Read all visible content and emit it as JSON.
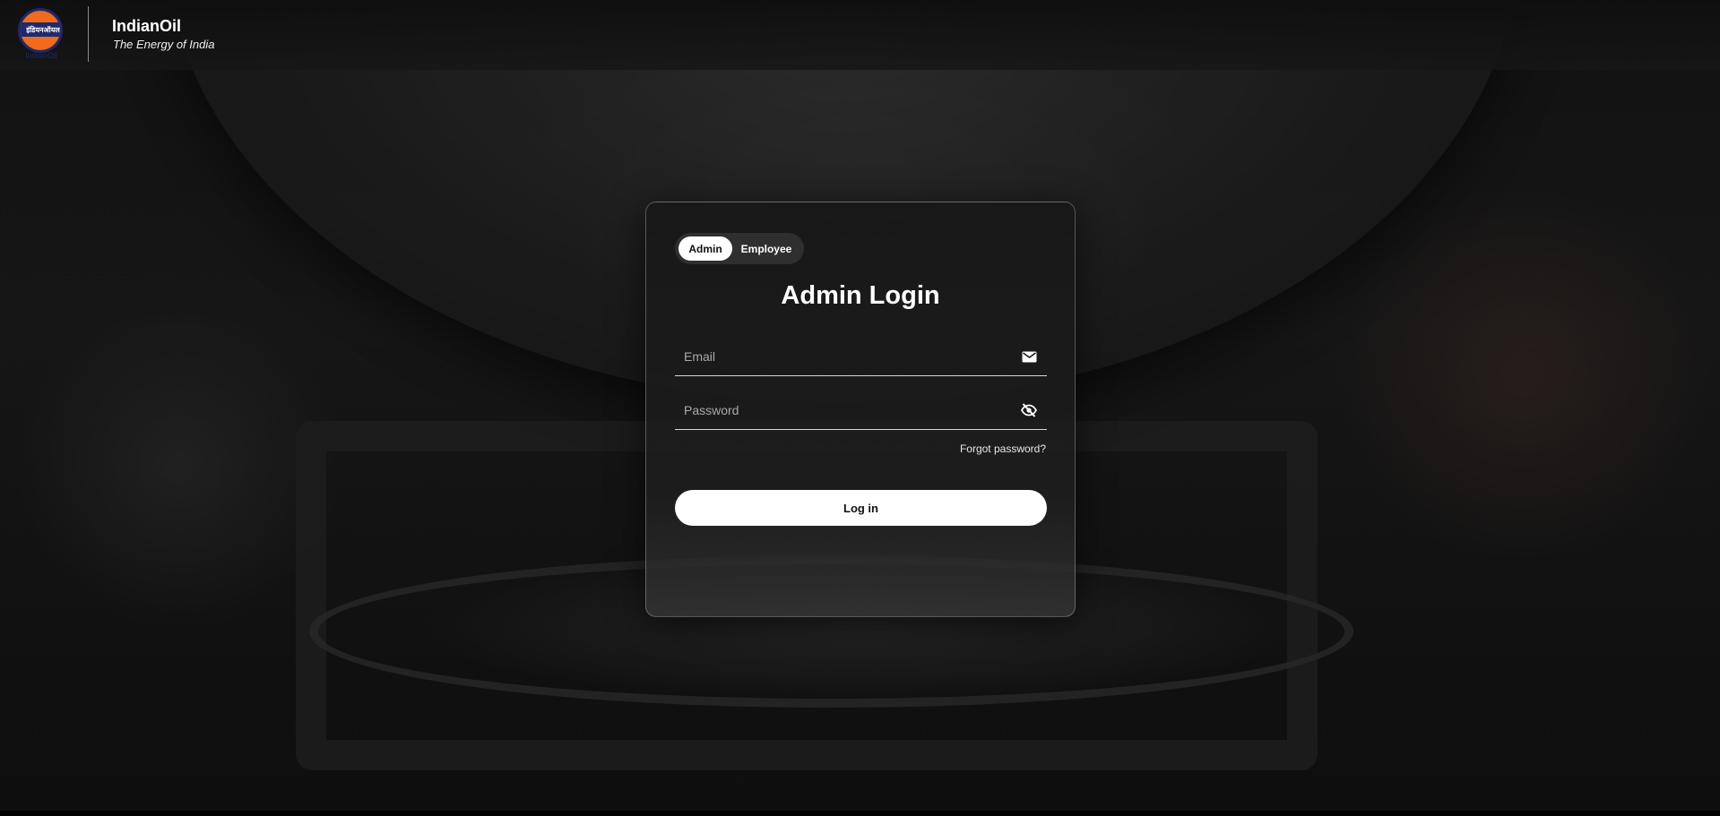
{
  "header": {
    "logo_text": "इंडियनऑयल",
    "logo_caption": "IndianOil",
    "brand_name": "IndianOil",
    "tagline": "The Energy of India"
  },
  "login": {
    "role_tabs": [
      {
        "label": "Admin",
        "active": true
      },
      {
        "label": "Employee",
        "active": false
      }
    ],
    "title": "Admin Login",
    "email": {
      "placeholder": "Email",
      "value": "",
      "icon": "mail-icon"
    },
    "password": {
      "placeholder": "Password",
      "value": "",
      "icon": "eye-off-icon"
    },
    "forgot_label": "Forgot password?",
    "submit_label": "Log in"
  },
  "colors": {
    "logo_orange": "#f26a1b",
    "logo_blue": "#1d2a6b",
    "card_bg": "#1a1a1a",
    "button_bg": "#ffffff"
  }
}
